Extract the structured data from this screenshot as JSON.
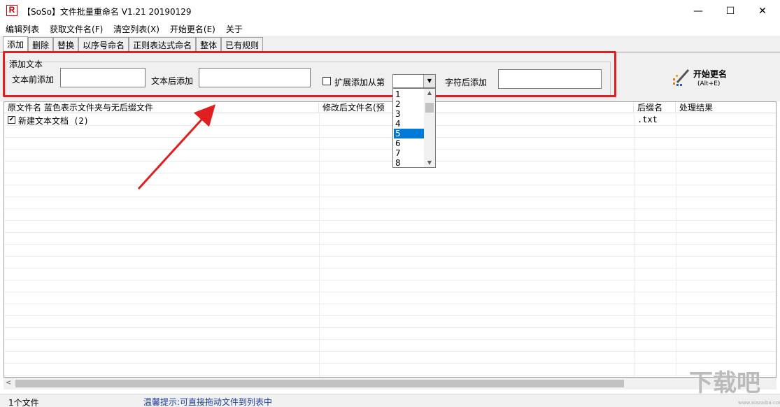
{
  "window": {
    "icon_letter": "R",
    "title": "【SoSo】文件批量重命名   V1.21 20190129",
    "minimize": "—",
    "maximize": "☐",
    "close": "✕"
  },
  "menu": [
    "编辑列表",
    "获取文件名(F)",
    "清空列表(X)",
    "开始更名(E)",
    "关于"
  ],
  "tabs": [
    "添加",
    "删除",
    "替换",
    "以序号命名",
    "正则表达式命名",
    "整体",
    "已有规则"
  ],
  "active_tab": 0,
  "add_text": {
    "group_title": "添加文本",
    "prefix_label": "文本前添加",
    "prefix_value": "",
    "suffix_label": "文本后添加",
    "suffix_value": "",
    "extend_label": "扩展添加从第",
    "extend_checked": false,
    "position_value": "",
    "position_options": [
      "1",
      "2",
      "3",
      "4",
      "5",
      "6",
      "7",
      "8"
    ],
    "selected_option": "5",
    "after_char_label": "字符后添加",
    "after_char_value": ""
  },
  "start_button": {
    "label": "开始更名",
    "shortcut": "(Alt+E)"
  },
  "list": {
    "columns": [
      "原文件名  蓝色表示文件夹与无后缀文件",
      "修改后文件名(预",
      "后缀名",
      "处理结果"
    ],
    "rows": [
      {
        "checked": true,
        "original": "新建文本文档 (2)",
        "renamed": "",
        "ext": ".txt",
        "result": ""
      }
    ]
  },
  "status": {
    "count": "1个文件",
    "hint": "温馨提示:可直接拖动文件到列表中"
  },
  "watermark": {
    "text": "下载吧",
    "url": "www.xiazaiba.com"
  },
  "colors": {
    "annotation": "#e02020",
    "selection": "#0078d7",
    "hint": "#1a3c9c"
  }
}
